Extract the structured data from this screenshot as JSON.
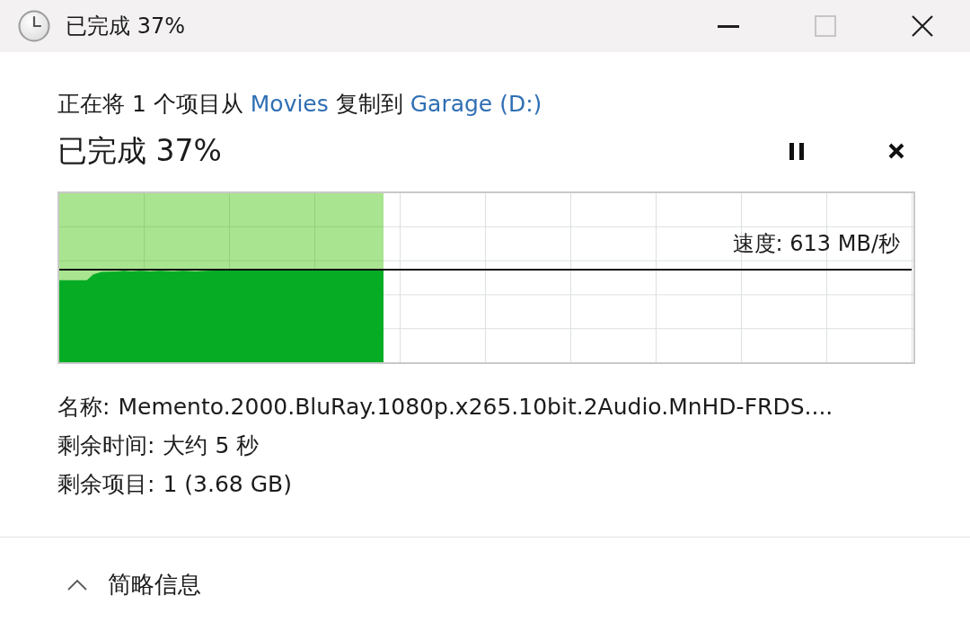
{
  "window": {
    "title": "已完成 37%",
    "buttons": [
      {
        "kind": "minimize",
        "disabled": false
      },
      {
        "kind": "maximize",
        "disabled": true
      },
      {
        "kind": "close",
        "disabled": false
      }
    ]
  },
  "summary": [
    {
      "kind": "text",
      "text": "正在将 1 个项目从"
    },
    {
      "kind": "link",
      "text": "Movies"
    },
    {
      "kind": "text",
      "text": "复制到"
    },
    {
      "kind": "link",
      "text": "Garage (D:)"
    }
  ],
  "status": "已完成 37%",
  "actions": [
    {
      "kind": "pause"
    },
    {
      "kind": "cancel"
    }
  ],
  "progress": {
    "level": 0.38,
    "speed": "速度: 613 MB/秒"
  },
  "details": [
    {
      "label": "名称:",
      "value": "Memento.2000.BluRay.1080p.x265.10bit.2Audio.MnHD-FRDS...."
    },
    {
      "label": "剩余时间:",
      "value": "大约 5 秒"
    },
    {
      "label": "剩余项目:",
      "value": "1 (3.68 GB)"
    }
  ],
  "details_toggle": {
    "label": "简略信息",
    "expanded": true
  }
}
